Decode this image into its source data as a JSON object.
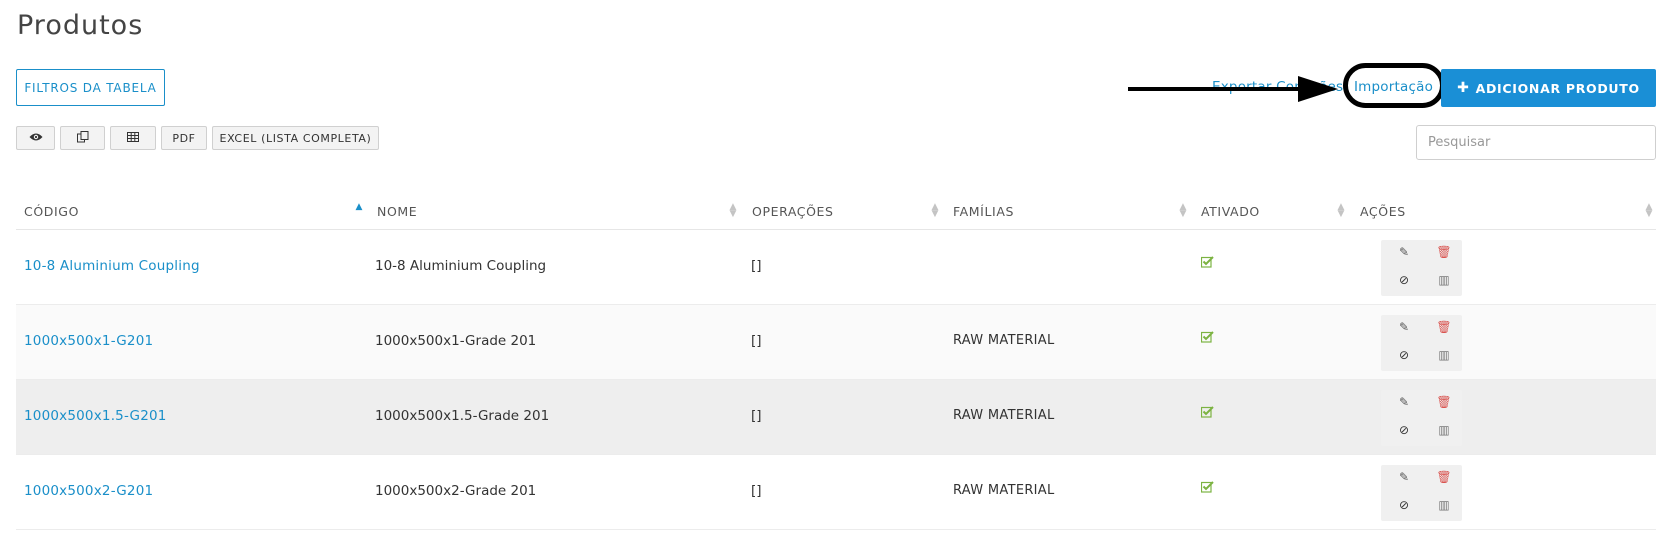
{
  "page": {
    "title": "Produtos"
  },
  "toolbar": {
    "filters_label": "FILTROS DA TABELA",
    "export_label": "Exportar Conexões",
    "import_label": "Importação",
    "add_label": "ADICIONAR PRODUTO",
    "pdf_label": "PDF",
    "excel_label": "EXCEL (LISTA COMPLETA)",
    "search_placeholder": "Pesquisar"
  },
  "table": {
    "headers": {
      "code": "CÓDIGO",
      "name": "NOME",
      "operations": "OPERAÇÕES",
      "families": "FAMÍLIAS",
      "active": "ATIVADO",
      "actions": "AÇÕES"
    },
    "sorted_column": "code",
    "rows": [
      {
        "code": "10-8 Aluminium Coupling",
        "name": "10-8 Aluminium Coupling",
        "operations": "[]",
        "families": "",
        "active": true
      },
      {
        "code": "1000x500x1-G201",
        "name": "1000x500x1-Grade 201",
        "operations": "[]",
        "families": "RAW MATERIAL",
        "active": true
      },
      {
        "code": "1000x500x1.5-G201",
        "name": "1000x500x1.5-Grade 201",
        "operations": "[]",
        "families": "RAW MATERIAL",
        "active": true
      },
      {
        "code": "1000x500x2-G201",
        "name": "1000x500x2-Grade 201",
        "operations": "[]",
        "families": "RAW MATERIAL",
        "active": true
      }
    ]
  },
  "colors": {
    "accent": "#1a8fc9",
    "primary_button": "#1a8fd6",
    "delete": "#d9534f",
    "check": "#7cb342"
  }
}
